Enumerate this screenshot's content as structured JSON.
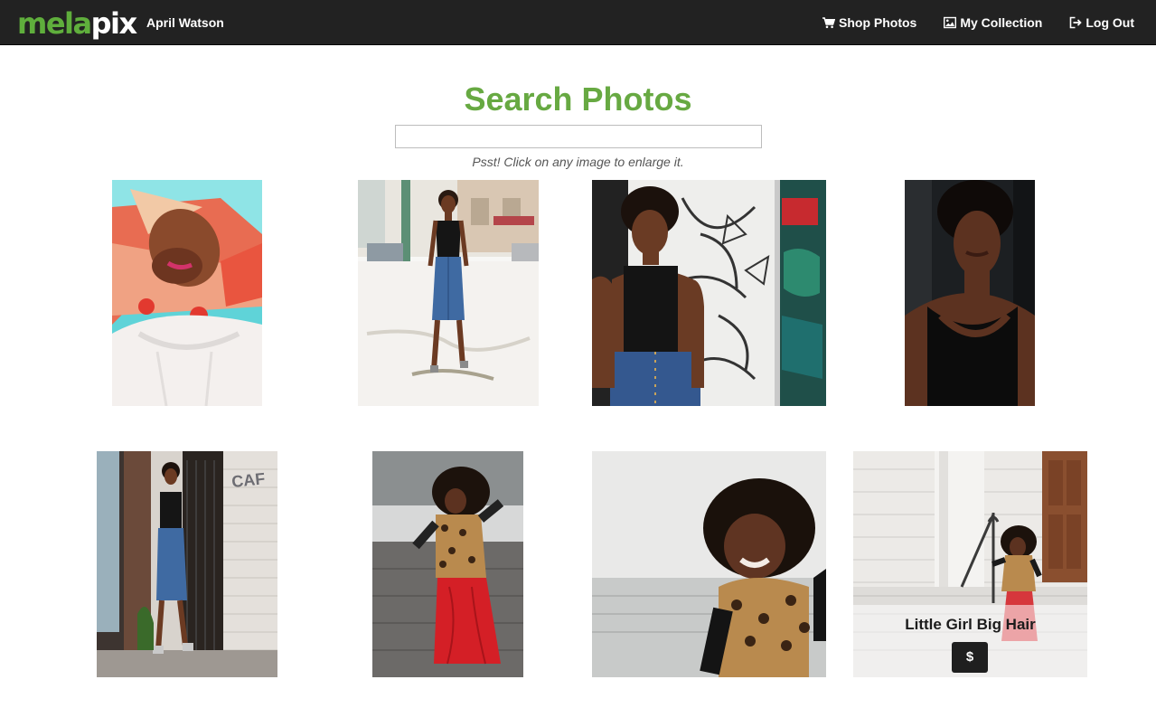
{
  "brand": {
    "part1": "mela",
    "part2": "pix"
  },
  "user": {
    "name": "April Watson"
  },
  "nav": {
    "shop": {
      "label": "Shop Photos",
      "icon": "cart-icon"
    },
    "collection": {
      "label": "My Collection",
      "icon": "picture-icon"
    },
    "logout": {
      "label": "Log Out",
      "icon": "logout-icon"
    }
  },
  "search": {
    "title": "Search Photos",
    "value": "",
    "placeholder": "",
    "hint": "Psst! Click on any image to enlarge it."
  },
  "photos": [
    {
      "subject": "woman-bald-colorful-wall"
    },
    {
      "subject": "woman-walking-street"
    },
    {
      "subject": "woman-graffiti-wall"
    },
    {
      "subject": "woman-portrait-dark"
    },
    {
      "subject": "woman-brick-wall-doorway"
    },
    {
      "subject": "girl-leopard-vest-jumping"
    },
    {
      "subject": "girl-smiling-curly-hair"
    },
    {
      "subject": "girl-on-steps",
      "title": "Little Girl Big Hair",
      "button_label": "$"
    }
  ],
  "colors": {
    "brand_green": "#5fae3c",
    "title_green": "#67a942",
    "navbar_bg": "#222222"
  }
}
